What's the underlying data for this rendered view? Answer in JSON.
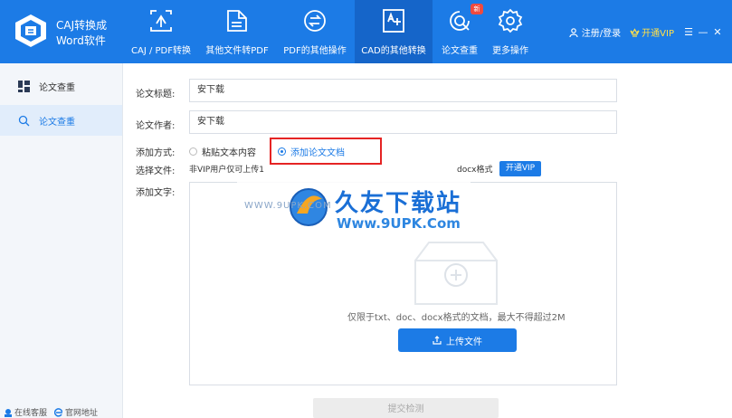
{
  "app": {
    "name_line1": "CAJ转换成",
    "name_line2": "Word软件"
  },
  "nav": [
    {
      "label": "CAJ / PDF转换",
      "icon": "caj-pdf-convert-icon"
    },
    {
      "label": "其他文件转PDF",
      "icon": "file-to-pdf-icon"
    },
    {
      "label": "PDF的其他操作",
      "icon": "pdf-operations-icon"
    },
    {
      "label": "CAD的其他转换",
      "icon": "cad-convert-icon"
    },
    {
      "label": "论文查重",
      "icon": "paper-check-icon",
      "badge": "新"
    },
    {
      "label": "更多操作",
      "icon": "gear-icon"
    }
  ],
  "top_right": {
    "login": "注册/登录",
    "vip": "开通VIP"
  },
  "sidebar": {
    "items": [
      {
        "label": "论文查重",
        "icon": "grid-icon"
      },
      {
        "label": "论文查重",
        "icon": "search-icon"
      }
    ],
    "footer": {
      "service": "在线客服",
      "website": "官网地址"
    }
  },
  "form": {
    "title_label": "论文标题:",
    "title_value": "安下载",
    "author_label": "论文作者:",
    "author_value": "安下载",
    "method_label": "添加方式:",
    "option_paste": "粘贴文本内容",
    "option_doc": "添加论文文档",
    "file_label": "选择文件:",
    "file_note_start": "非VIP用户仅可上传1",
    "file_note_end": "docx格式",
    "vip_button": "开通VIP",
    "add_text_label": "添加文字:",
    "upload_hint": "仅限于txt、doc、docx格式的文档，最大不得超过2M",
    "upload_button": "上传文件",
    "submit_button": "提交检测"
  },
  "watermark": {
    "brand": "久友下载站",
    "url": "Www.9UPK.Com",
    "url_small": "WWW.9UPK.COM"
  },
  "colors": {
    "primary": "#1c7be6",
    "highlight_border": "#e52424",
    "vip_yellow": "#ffe14a"
  }
}
